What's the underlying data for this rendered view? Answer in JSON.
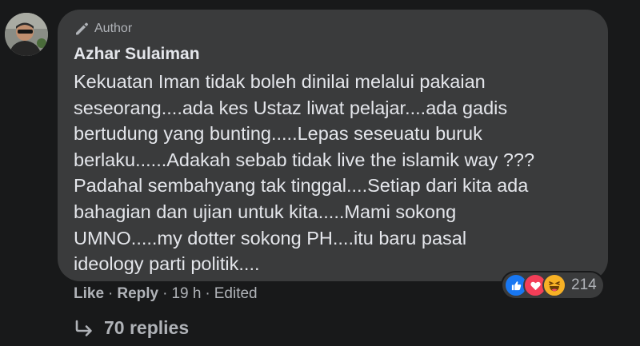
{
  "comment": {
    "author_badge": "Author",
    "author_name": "Azhar Sulaiman",
    "text": "Kekuatan Iman tidak boleh dinilai melalui pakaian\nseseorang....ada kes Ustaz liwat pelajar....ada gadis\nbertudung yang bunting.....Lepas seseuatu buruk\nberlaku......Adakah sebab tidak live the islamik way ???\nPadahal sembahyang tak tinggal....Setiap dari kita ada\nbahagian dan ujian untuk kita.....Mami sokong\nUMNO.....my dotter sokong PH....itu baru pasal\nideology parti politik....",
    "reactions": {
      "icons": [
        "like-reaction-icon",
        "love-reaction-icon",
        "haha-reaction-icon"
      ],
      "count": "214"
    }
  },
  "actions": {
    "like": "Like",
    "separator": "·",
    "reply": "Reply",
    "time": "19 h",
    "edited": "Edited"
  },
  "replies": {
    "label": "70 replies"
  },
  "colors": {
    "background": "#18191a",
    "bubble": "#3a3b3c",
    "primary_text": "#e4e6eb",
    "secondary_text": "#b0b3b8",
    "like_blue": "#1877f2",
    "love_red": "#f33e58",
    "haha_yellow": "#f7b125"
  }
}
